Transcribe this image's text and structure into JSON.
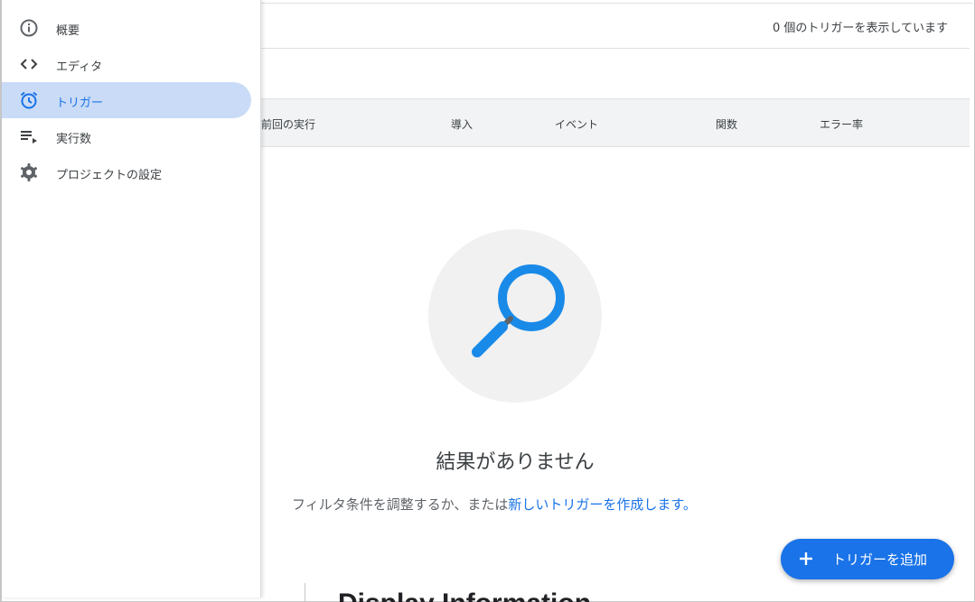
{
  "sidebar": {
    "items": [
      {
        "label": "概要",
        "icon": "info-icon"
      },
      {
        "label": "エディタ",
        "icon": "code-icon"
      },
      {
        "label": "トリガー",
        "icon": "alarm-clock-icon",
        "active": true
      },
      {
        "label": "実行数",
        "icon": "playlist-icon"
      },
      {
        "label": "プロジェクトの設定",
        "icon": "gear-icon"
      }
    ]
  },
  "main": {
    "count_text": "0 個のトリガーを表示しています",
    "columns": [
      "前回の実行",
      "導入",
      "イベント",
      "関数",
      "エラー率"
    ],
    "empty": {
      "title": "結果がありません",
      "subtitle_prefix": "フィルタ条件を調整するか、または",
      "subtitle_link": "新しいトリガーを作成します。"
    },
    "fab_label": "トリガーを追加",
    "background_peek_text": "Display Information"
  },
  "colors": {
    "accent": "#1a73e8",
    "active_bg": "#c9dbf6",
    "magnifier": "#1a8ae8"
  }
}
